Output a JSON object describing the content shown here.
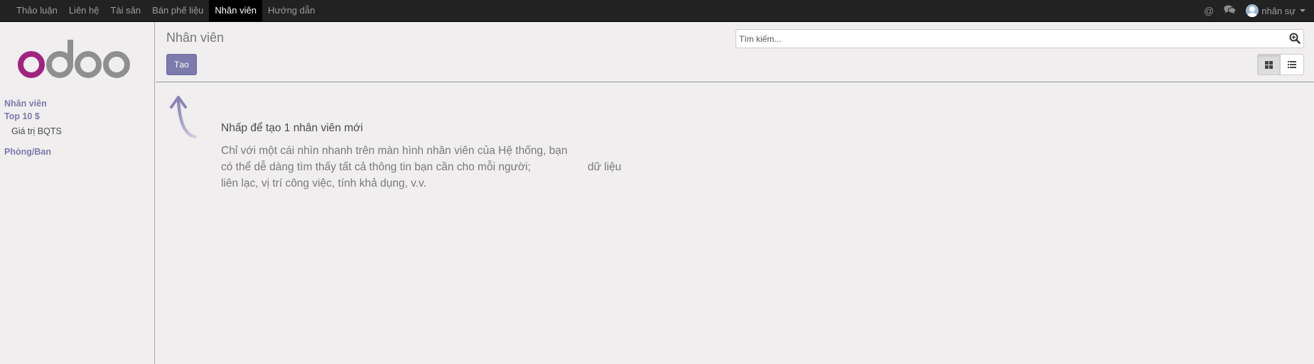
{
  "topbar": {
    "menu": [
      {
        "label": "Thảo luận"
      },
      {
        "label": "Liên hệ"
      },
      {
        "label": "Tài sản"
      },
      {
        "label": "Bán phế liệu"
      },
      {
        "label": "Nhân viên",
        "active": true
      },
      {
        "label": "Hướng dẫn"
      }
    ],
    "at_icon": "@",
    "chat_icon": "chat-bubbles",
    "user_name": "nhân sự"
  },
  "sidebar": {
    "logo_text": "odoo",
    "section1_title": "Nhân viên",
    "section1_subtitle": "Top 10 $",
    "section1_item": "Giá trị BQTS",
    "section2_title": "Phòng/Ban"
  },
  "control_panel": {
    "breadcrumb": "Nhân viên",
    "search_placeholder": "Tìm kiếm...",
    "create_label": "Tạo",
    "view_modes": [
      "kanban",
      "list"
    ]
  },
  "help": {
    "title": "Nhấp để tạo 1 nhân viên mới",
    "line1": "Chỉ với một cái nhìn nhanh trên màn hình nhân viên của Hệ thống, bạn",
    "line2": "có thể dễ dàng tìm thấy tất cả thông tin bạn cần cho mỗi người;",
    "line2_tail": "dữ liệu",
    "line3": "liên lạc, vị trí công việc, tính khả dụng, v.v."
  },
  "colors": {
    "accent": "#7c7bad",
    "logo_purple": "#a2227f",
    "logo_gray": "#8f8f8f",
    "topbar": "#222222"
  }
}
